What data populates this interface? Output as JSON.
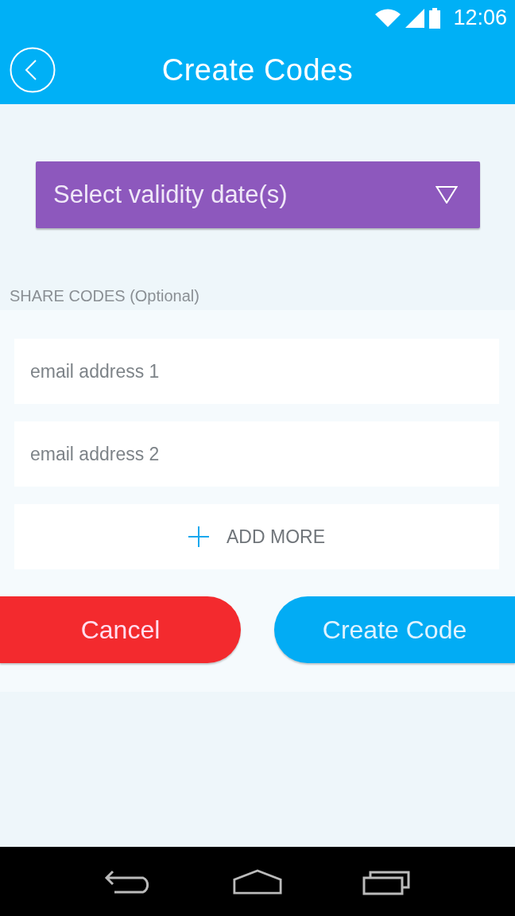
{
  "status_bar": {
    "time": "12:06"
  },
  "header": {
    "title": "Create Codes"
  },
  "validity_dropdown": {
    "placeholder": "Select validity date(s)"
  },
  "share_section": {
    "label": "SHARE CODES (Optional)",
    "email_fields": [
      {
        "placeholder": "email address 1"
      },
      {
        "placeholder": "email address 2"
      }
    ],
    "add_more": "ADD MORE"
  },
  "buttons": [
    {
      "kind": "cancel",
      "label": "Cancel"
    },
    {
      "kind": "create",
      "label": "Create Code"
    }
  ]
}
